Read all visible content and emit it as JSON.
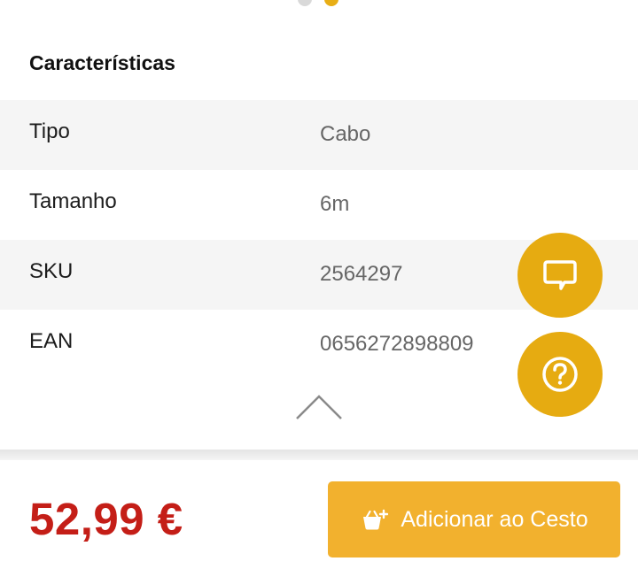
{
  "carousel": {
    "page_count": 2,
    "active_index": 1
  },
  "characteristics": {
    "title": "Características",
    "rows": [
      {
        "label": "Tipo",
        "value": "Cabo"
      },
      {
        "label": "Tamanho",
        "value": "6m"
      },
      {
        "label": "SKU",
        "value": "2564297"
      },
      {
        "label": "EAN",
        "value": "0656272898809"
      }
    ]
  },
  "icons": {
    "collapse": "chevron-up-icon",
    "chat": "chat-bubble-icon",
    "help": "question-circle-icon",
    "cart": "basket-plus-icon"
  },
  "footer": {
    "price": "52,99 €",
    "add_to_cart_label": "Adicionar ao Cesto"
  },
  "colors": {
    "accent": "#e6ab11",
    "button": "#f2b12e",
    "price": "#c41e17",
    "row_shade": "#f5f5f5"
  }
}
